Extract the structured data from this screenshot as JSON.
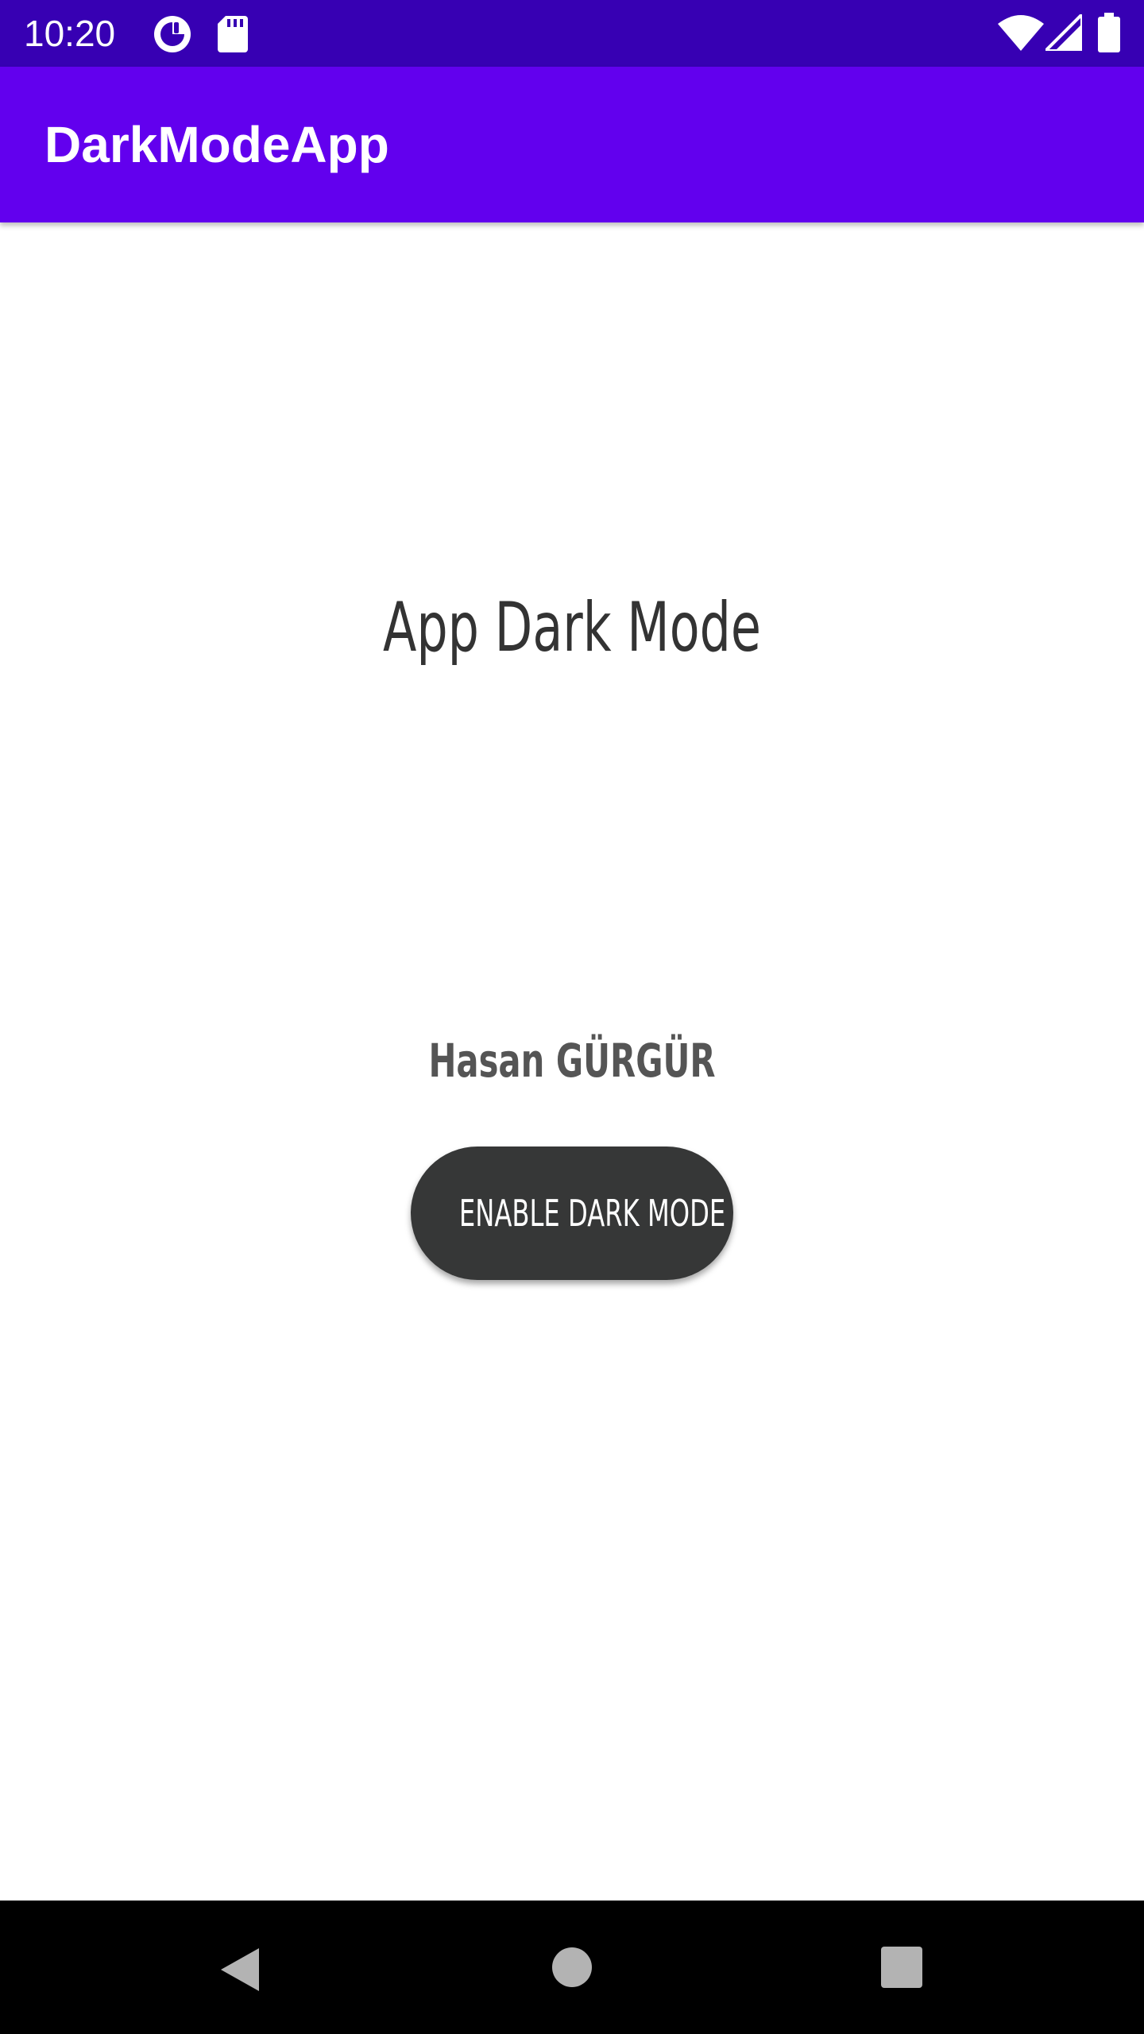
{
  "status_bar": {
    "time": "10:20",
    "icons": [
      "data-saver-icon",
      "sd-card-icon",
      "wifi-icon",
      "cell-signal-icon",
      "battery-icon"
    ],
    "background": "#3700b3"
  },
  "app_bar": {
    "title": "DarkModeApp",
    "background": "#6200ee"
  },
  "main": {
    "headline": "App Dark Mode",
    "author": "Hasan GÜRGÜR",
    "button_label": "ENABLE DARK MODE",
    "button_color": "#363737"
  },
  "nav_bar": {
    "buttons": [
      "back-icon",
      "home-icon",
      "recents-icon"
    ]
  }
}
